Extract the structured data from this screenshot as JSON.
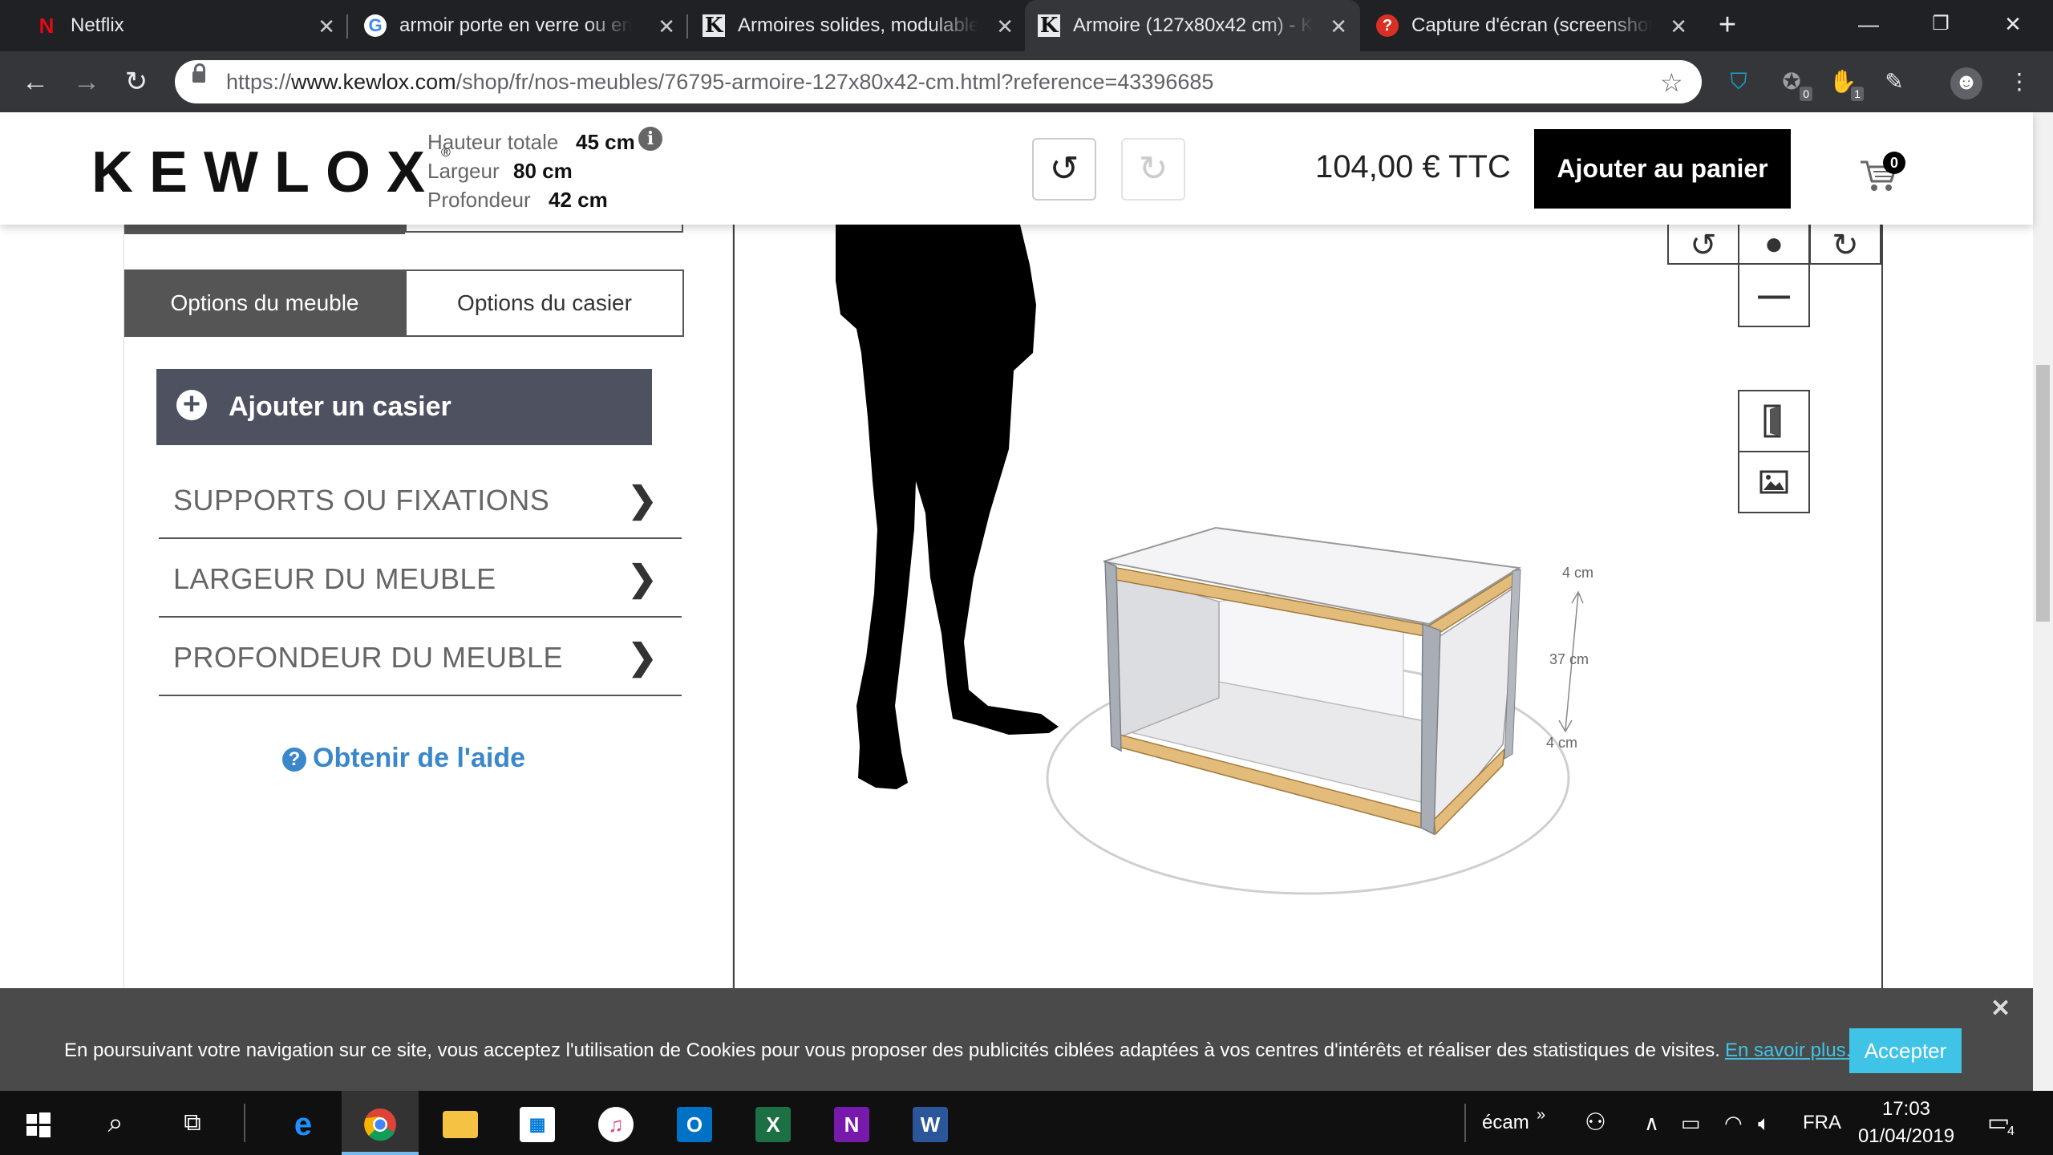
{
  "browser": {
    "tabs": [
      {
        "title": "Netflix",
        "favicon": "N"
      },
      {
        "title": "armoir porte en verre ou en",
        "favicon": "G"
      },
      {
        "title": "Armoires solides, modulables",
        "favicon": "K"
      },
      {
        "title": "Armoire (127x80x42 cm) - K",
        "favicon": "K"
      },
      {
        "title": "Capture d'écran (screenshot",
        "favicon": "?"
      }
    ],
    "active_tab_index": 3,
    "url_prefix": "https://",
    "url_host": "www.kewlox.com",
    "url_path": "/shop/fr/nos-meubles/76795-armoire-127x80x42-cm.html?reference=43396685",
    "extension_badges": [
      "0",
      "1"
    ]
  },
  "site": {
    "logo": "KEWLOX",
    "logo_mark": "®",
    "dimensions": [
      {
        "label": "Hauteur totale",
        "value": "45 cm"
      },
      {
        "label": "Largeur",
        "value": "80 cm"
      },
      {
        "label": "Profondeur",
        "value": "42 cm"
      }
    ],
    "price": "104,00 € TTC",
    "add_to_cart": "Ajouter au panier",
    "cart_count": "0"
  },
  "panel": {
    "tabs": [
      "Options du meuble",
      "Options du casier"
    ],
    "active_tab": 0,
    "add_casier": "Ajouter un casier",
    "accordion": [
      "SUPPORTS OU FIXATIONS",
      "LARGEUR DU MEUBLE",
      "PROFONDEUR DU MEUBLE"
    ],
    "help": "Obtenir de l'aide"
  },
  "viewer": {
    "dimension_labels": {
      "top": "4 cm",
      "middle": "37 cm",
      "bottom": "4 cm"
    },
    "colors": {
      "wood": "#e3bb7b",
      "panel": "#f2f2f4",
      "edge": "#a9aeb6",
      "silhouette": "#000000"
    }
  },
  "cookie": {
    "text": "En poursuivant votre navigation sur ce site, vous acceptez l'utilisation de Cookies pour vous proposer des publicités ciblées adaptées à vos centres d'intérêts et réaliser des statistiques de visites.",
    "more_link": "En savoir plus.",
    "accept": "Accepter",
    "accent_color": "#3fc3e6"
  },
  "taskbar": {
    "search_text": "écam",
    "language": "FRA",
    "time": "17:03",
    "date": "01/04/2019",
    "notification_count": "4"
  }
}
